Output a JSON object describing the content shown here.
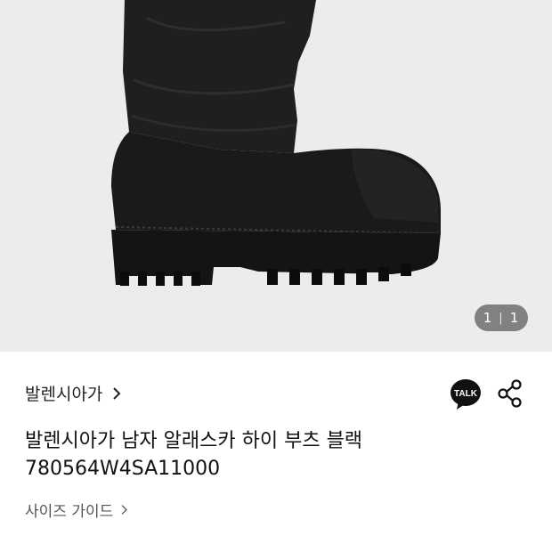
{
  "gallery": {
    "current": "1",
    "total": "1"
  },
  "brand": {
    "name": "발렌시아가"
  },
  "product": {
    "title_line1": "발렌시아가 남자 알래스카 하이 부츠 블랙",
    "title_line2": "780564W4SA11000"
  },
  "links": {
    "size_guide": "사이즈 가이드"
  },
  "actions": {
    "talk_label": "TALK"
  },
  "colors": {
    "hero_bg": "#ececee",
    "boot": "#1a1a1c",
    "counter_bg": "#6e6e70"
  },
  "icons": [
    "chevron-right-icon",
    "kakao-talk-icon",
    "share-icon"
  ]
}
